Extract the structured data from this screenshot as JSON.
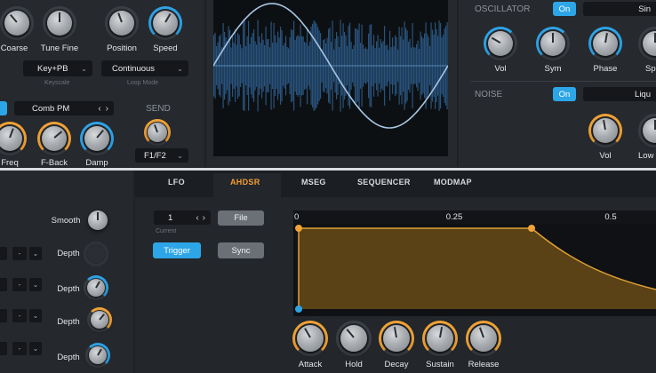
{
  "top_left": {
    "knobs": [
      {
        "label": "Coarse"
      },
      {
        "label": "Tune Fine"
      },
      {
        "label": "Position"
      },
      {
        "label": "Speed"
      }
    ],
    "keyscale": {
      "value": "Key+PB",
      "caption": "Keyscale"
    },
    "loop_mode": {
      "value": "Continuous",
      "caption": "Loop Mode"
    },
    "filter": {
      "toggle": "On",
      "value": "Comb PM"
    },
    "filter_knobs": [
      {
        "label": "Freq"
      },
      {
        "label": "F-Back"
      },
      {
        "label": "Damp"
      }
    ],
    "send": {
      "title": "SEND",
      "value": "F1/F2"
    }
  },
  "oscillator": {
    "title": "OSCILLATOR",
    "toggle": "On",
    "waveform": "Sin",
    "knobs": [
      {
        "label": "Vol"
      },
      {
        "label": "Sym"
      },
      {
        "label": "Phase"
      },
      {
        "label": "Sp"
      }
    ]
  },
  "noise": {
    "title": "NOISE",
    "toggle": "On",
    "type": "Liqu",
    "knobs": [
      {
        "label": "Vol"
      },
      {
        "label": "Low"
      }
    ]
  },
  "mod_left": {
    "smooth_label": "Smooth",
    "rows": [
      {
        "dash": "-",
        "depth": "Depth"
      },
      {
        "dash": "-",
        "depth": "Depth"
      },
      {
        "dash": "-",
        "depth": "Depth"
      },
      {
        "dash": "-",
        "depth": "Depth"
      }
    ]
  },
  "tabs": [
    {
      "label": "LFO",
      "active": false
    },
    {
      "label": "AHDSR",
      "active": true
    },
    {
      "label": "MSEG",
      "active": false
    },
    {
      "label": "SEQUENCER",
      "active": false
    },
    {
      "label": "MODMAP",
      "active": false
    }
  ],
  "envelope": {
    "current": {
      "value": "1",
      "caption": "Current"
    },
    "file_label": "File",
    "trigger_label": "Trigger",
    "sync_label": "Sync",
    "ruler": [
      "0",
      "0.25",
      "0.5"
    ],
    "knobs": [
      {
        "label": "Attack"
      },
      {
        "label": "Hold"
      },
      {
        "label": "Decay"
      },
      {
        "label": "Sustain"
      },
      {
        "label": "Release"
      }
    ]
  },
  "colors": {
    "accent_blue": "#2ea3e6",
    "accent_orange": "#f0a236",
    "background": "#1e2125"
  }
}
